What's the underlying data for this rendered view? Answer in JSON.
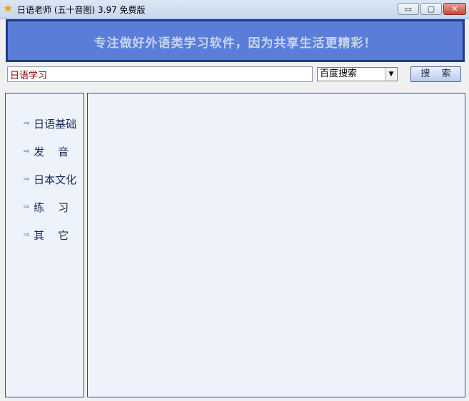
{
  "window": {
    "title": "日语老师 (五十音图) 3.97 免费版",
    "app_icon": "star-icon",
    "controls": {
      "minimize": "▭",
      "maximize": "▢",
      "close": "✕"
    }
  },
  "banner": {
    "slogan": "专注做好外语类学习软件，因为共享生活更精彩！"
  },
  "search": {
    "query": "日语学习",
    "engine_selected": "百度搜索",
    "engine_arrow": "▼",
    "button_label": "搜 索"
  },
  "sidebar": {
    "items": [
      {
        "label": "日语基础",
        "icon": "arrow-right-icon",
        "arrow": "⇨"
      },
      {
        "label": "发    音",
        "icon": "arrow-right-icon",
        "arrow": "⇨"
      },
      {
        "label": "日本文化",
        "icon": "arrow-right-icon",
        "arrow": "⇨"
      },
      {
        "label": "练    习",
        "icon": "arrow-right-icon",
        "arrow": "⇨"
      },
      {
        "label": "其    它",
        "icon": "arrow-right-icon",
        "arrow": "⇨"
      }
    ]
  },
  "colors": {
    "banner_bg": "#5a7ed8",
    "banner_border": "#223a8a",
    "panel_bg": "#eef2fb",
    "query_text": "#800000"
  }
}
